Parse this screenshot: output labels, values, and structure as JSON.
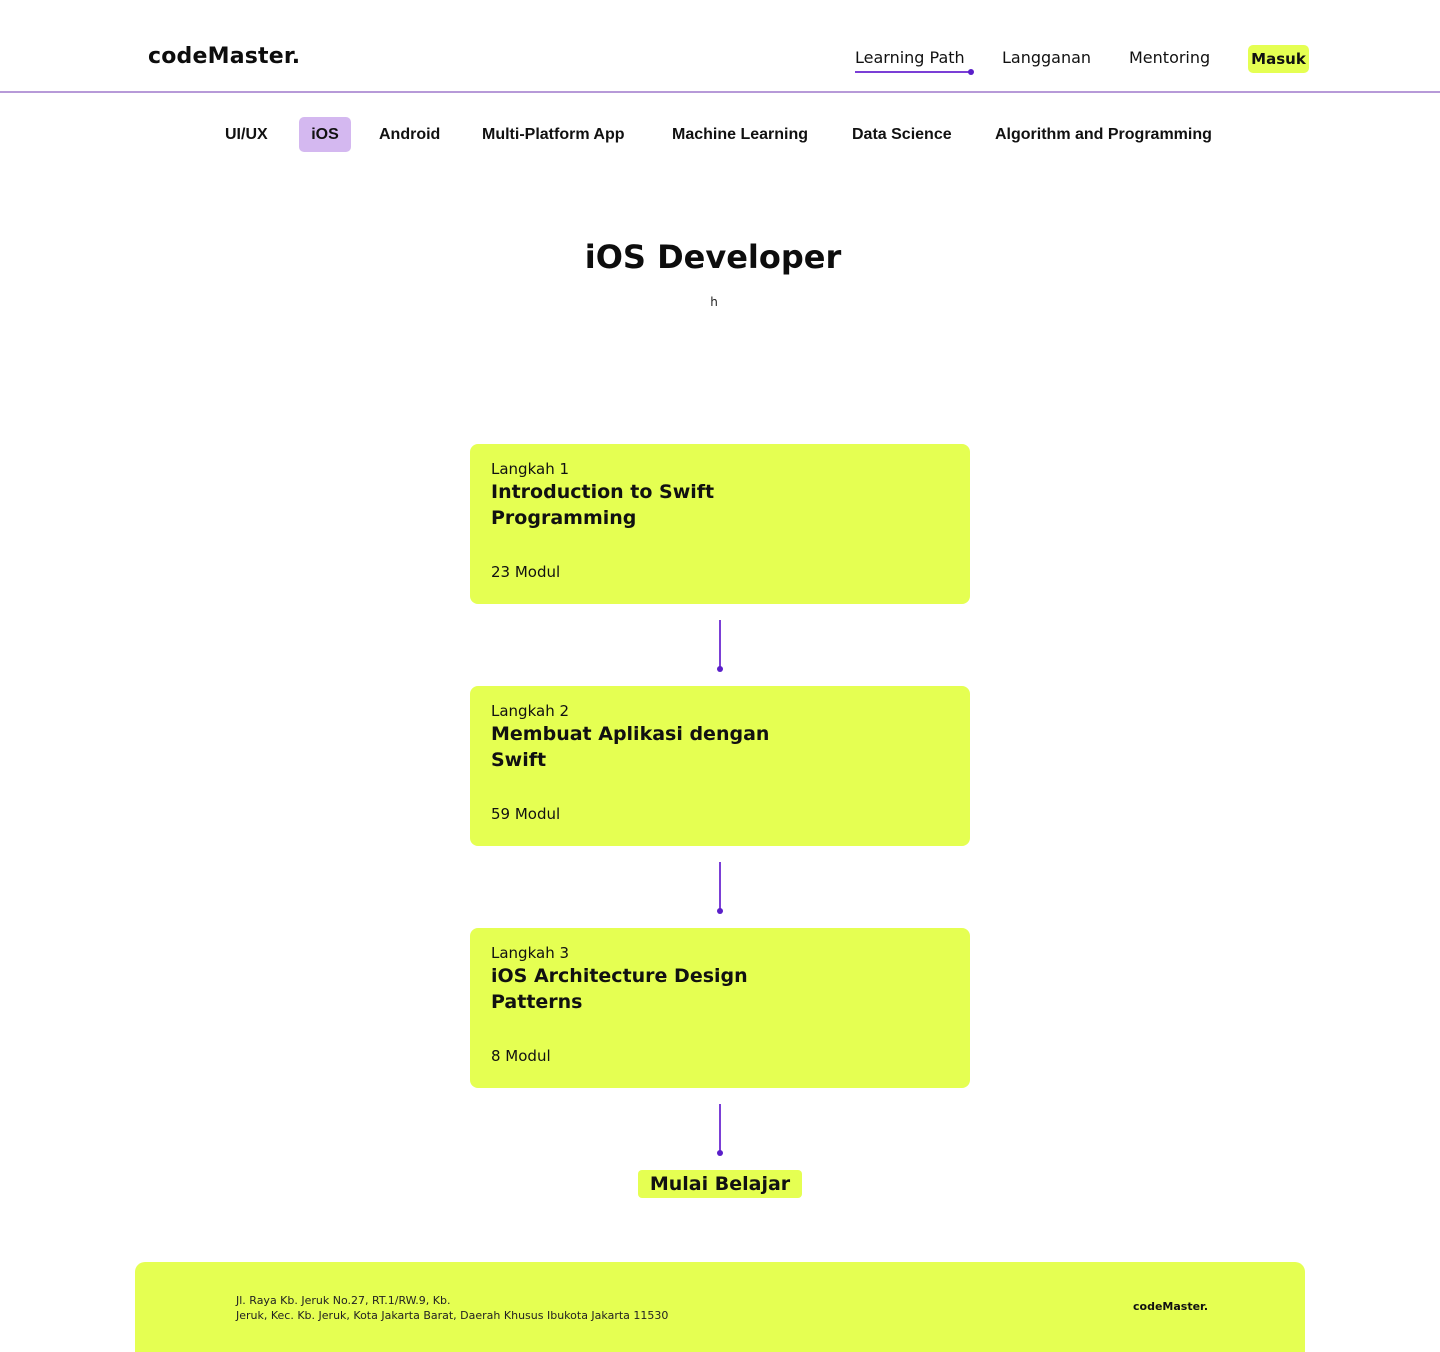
{
  "header": {
    "logo": "codeMaster.",
    "nav": {
      "learning_path": "Learning Path",
      "langganan": "Langganan",
      "mentoring": "Mentoring"
    },
    "login_label": "Masuk"
  },
  "categories": {
    "items": [
      "UI/UX",
      "iOS",
      "Android",
      "Multi-Platform App",
      "Machine Learning",
      "Data Science",
      "Algorithm and Programming"
    ],
    "active": "iOS"
  },
  "page": {
    "title": "iOS Developer",
    "subtitle": "h"
  },
  "steps": [
    {
      "label": "Langkah 1",
      "title": "Introduction to Swift Programming",
      "modules": "23 Modul"
    },
    {
      "label": "Langkah 2",
      "title": "Membuat Aplikasi dengan Swift",
      "modules": "59 Modul"
    },
    {
      "label": "Langkah 3",
      "title": "iOS Architecture Design Patterns",
      "modules": "8 Modul"
    }
  ],
  "cta_label": "Mulai Belajar",
  "footer": {
    "address_line1": "Jl. Raya Kb. Jeruk No.27, RT.1/RW.9, Kb.",
    "address_line2": "Jeruk, Kec. Kb. Jeruk, Kota Jakarta Barat, Daerah Khusus Ibukota Jakarta 11530",
    "logo": "codeMaster."
  },
  "colors": {
    "accent_lime": "#e5ff52",
    "accent_purple": "#7b3fd6",
    "active_tab_bg": "#d4b8f0"
  }
}
